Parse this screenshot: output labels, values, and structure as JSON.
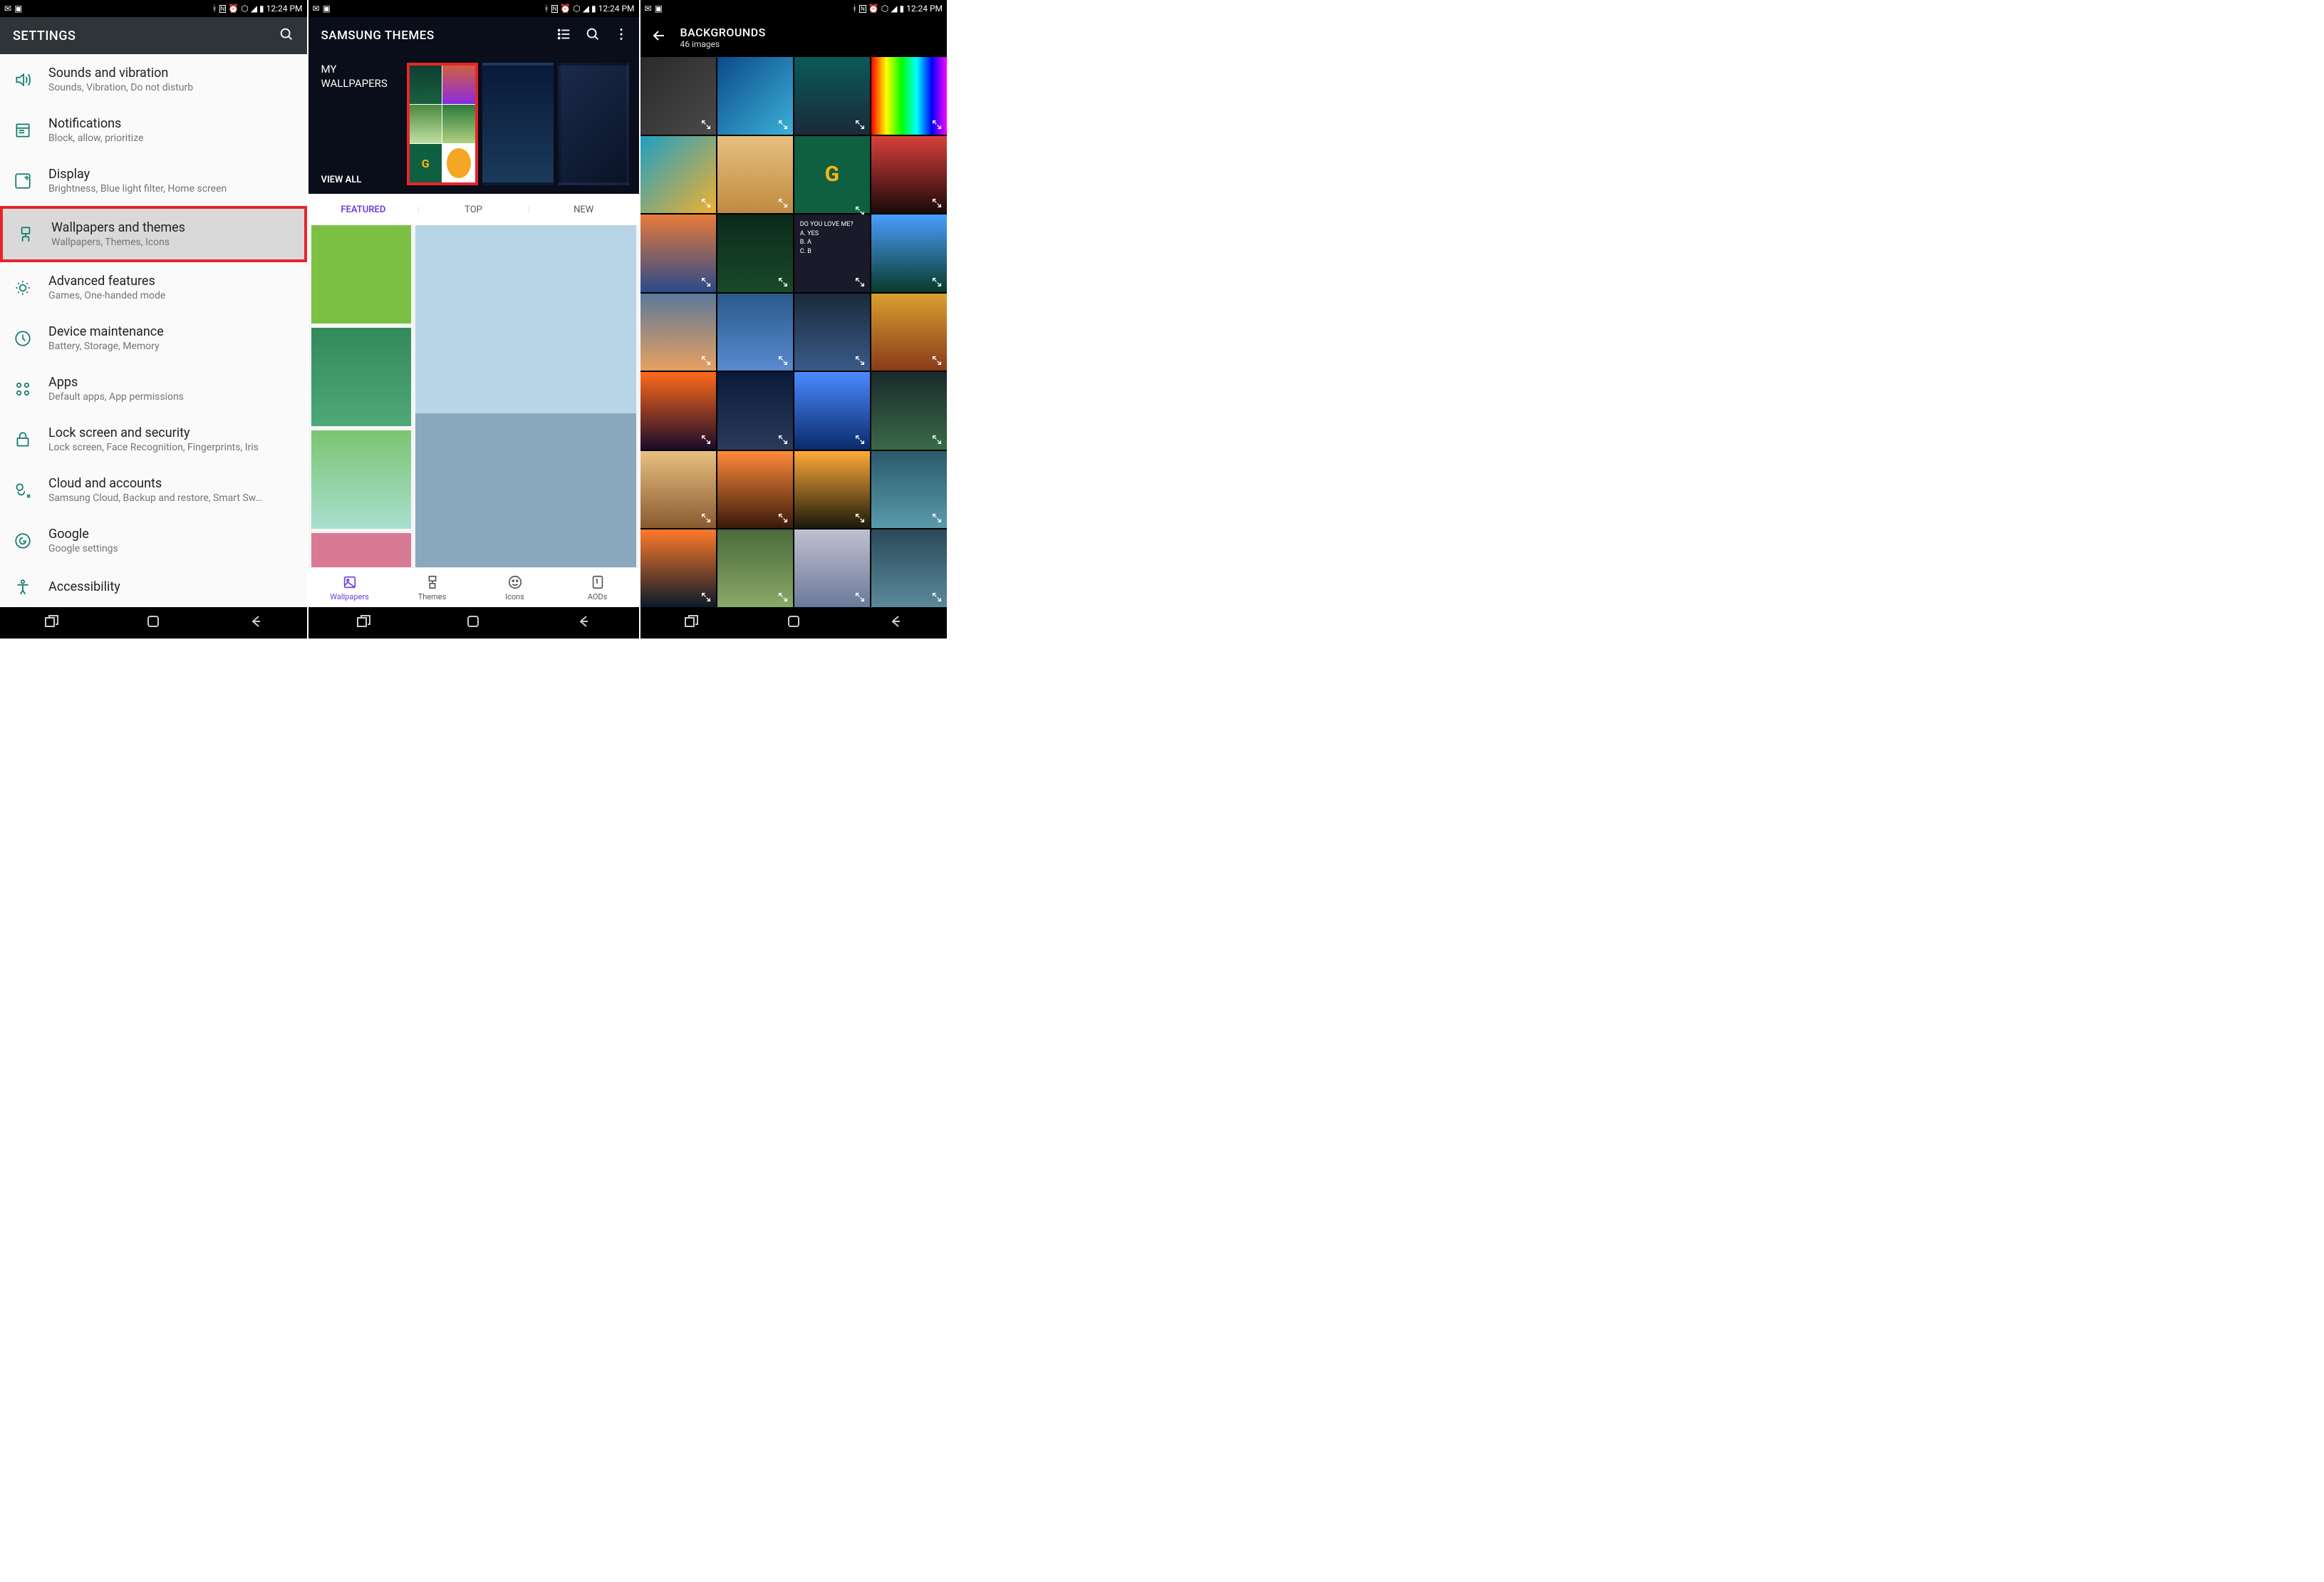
{
  "status": {
    "time": "12:24 PM"
  },
  "s1": {
    "title": "SETTINGS",
    "items": [
      {
        "icon": "sounds",
        "title": "Sounds and vibration",
        "sub": "Sounds, Vibration, Do not disturb",
        "hl": false
      },
      {
        "icon": "notif",
        "title": "Notifications",
        "sub": "Block, allow, prioritize",
        "hl": false
      },
      {
        "icon": "display",
        "title": "Display",
        "sub": "Brightness, Blue light filter, Home screen",
        "hl": false
      },
      {
        "icon": "wall",
        "title": "Wallpapers and themes",
        "sub": "Wallpapers, Themes, Icons",
        "hl": true
      },
      {
        "icon": "adv",
        "title": "Advanced features",
        "sub": "Games, One-handed mode",
        "hl": false
      },
      {
        "icon": "maint",
        "title": "Device maintenance",
        "sub": "Battery, Storage, Memory",
        "hl": false
      },
      {
        "icon": "apps",
        "title": "Apps",
        "sub": "Default apps, App permissions",
        "hl": false
      },
      {
        "icon": "lock",
        "title": "Lock screen and security",
        "sub": "Lock screen, Face Recognition, Fingerprints, Iris",
        "hl": false
      },
      {
        "icon": "cloud",
        "title": "Cloud and accounts",
        "sub": "Samsung Cloud, Backup and restore, Smart Sw…",
        "hl": false
      },
      {
        "icon": "google",
        "title": "Google",
        "sub": "Google settings",
        "hl": false
      },
      {
        "icon": "access",
        "title": "Accessibility",
        "sub": "",
        "hl": false
      }
    ]
  },
  "s2": {
    "title": "SAMSUNG THEMES",
    "mywall": "MY WALLPAPERS",
    "viewall": "VIEW ALL",
    "tabs": [
      {
        "label": "FEATURED",
        "active": true
      },
      {
        "label": "TOP",
        "active": false
      },
      {
        "label": "NEW",
        "active": false
      }
    ],
    "bottomnav": [
      {
        "label": "Wallpapers",
        "active": true
      },
      {
        "label": "Themes",
        "active": false
      },
      {
        "label": "Icons",
        "active": false
      },
      {
        "label": "AODs",
        "active": false
      }
    ]
  },
  "s3": {
    "title": "BACKGROUNDS",
    "sub": "46 images",
    "tile10_text": "DO YOU LOVE ME?\nA. YES\nB. A\nC. B"
  }
}
